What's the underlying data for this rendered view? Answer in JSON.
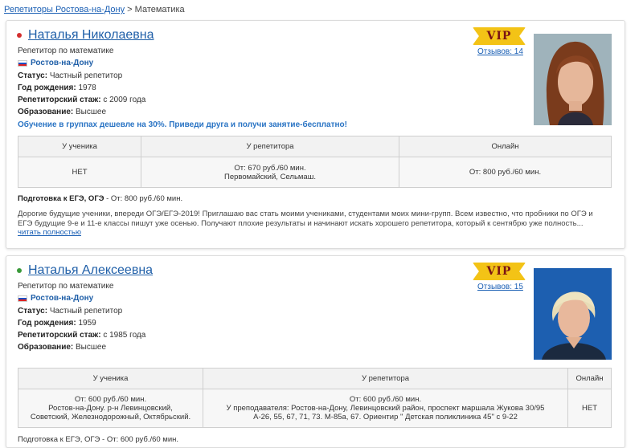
{
  "breadcrumb": {
    "link": "Репетиторы Ростова-на-Дону",
    "separator": ">",
    "current": "Математика"
  },
  "colors": {
    "online_dot_1": "#d32f2f",
    "online_dot_2": "#3a9a3a",
    "vip_bg": "#f3c316",
    "vip_text": "#7a1414",
    "link": "#1f5fa8"
  },
  "tutors": [
    {
      "name": "Наталья Николаевна",
      "subtitle": "Репетитор по математике",
      "city": "Ростов-на-Дону",
      "status_label": "Статус:",
      "status": "Частный репетитор",
      "birth_label": "Год рождения:",
      "birth": "1978",
      "experience_label": "Репетиторский стаж:",
      "experience": "с 2009 года",
      "education_label": "Образование:",
      "education": "Высшее",
      "promo": "Обучение в группах дешевле на 30%. Приведи друга и получи занятие-бесплатно!",
      "vip": "VIP",
      "reviews": "Отзывов: 14",
      "table_headers": [
        "У ученика",
        "У репетитора",
        "Онлайн"
      ],
      "at_student": "НЕТ",
      "at_tutor_line1": "От: 670 руб./60 мин.",
      "at_tutor_line2": "Первомайский, Сельмаш.",
      "online": "От: 800 руб./60 мин.",
      "ege_label": "Подготовка к ЕГЭ, ОГЭ",
      "ege_price": "- От: 800 руб./60 мин.",
      "description": "Дорогие будущие ученики, впереди ОГЭ/ЕГЭ-2019! Приглашаю вас стать моими учениками, студентами моих мини-групп. Всем известно, что пробники по ОГЭ и ЕГЭ будущие 9-е и 11-е классы пишут уже осенью. Получают плохие результаты и начинают искать хорошего репетитора, который к сентябрю уже полность...",
      "read_more": "читать полностью"
    },
    {
      "name": "Наталья Алексеевна",
      "subtitle": "Репетитор по математике",
      "city": "Ростов-на-Дону",
      "status_label": "Статус:",
      "status": "Частный репетитор",
      "birth_label": "Год рождения:",
      "birth": "1959",
      "experience_label": "Репетиторский стаж:",
      "experience": "с 1985 года",
      "education_label": "Образование:",
      "education": "Высшее",
      "vip": "VIP",
      "reviews": "Отзывов: 15",
      "table_headers": [
        "У ученика",
        "У репетитора",
        "Онлайн"
      ],
      "at_student_line1": "От: 600 руб./60 мин.",
      "at_student_line2": "Ростов-на-Дону. р-н Левинцовский,",
      "at_student_line3": "Советский, Железнодорожный, Октябрьский.",
      "at_tutor_line1": "От: 600 руб./60 мин.",
      "at_tutor_line2": "У преподавателя: Ростов-на-Дону, Левинцовский район, проспект маршала Жукова 30/95",
      "at_tutor_line3": "А-26, 55, 67, 71, 73. М-85а, 67. Ориентир \" Детская поликлиника 45\" с 9-22",
      "online": "НЕТ",
      "ege_partial": "Подготовка к ЕГЭ, ОГЭ - От: 600 руб./60 мин."
    }
  ]
}
